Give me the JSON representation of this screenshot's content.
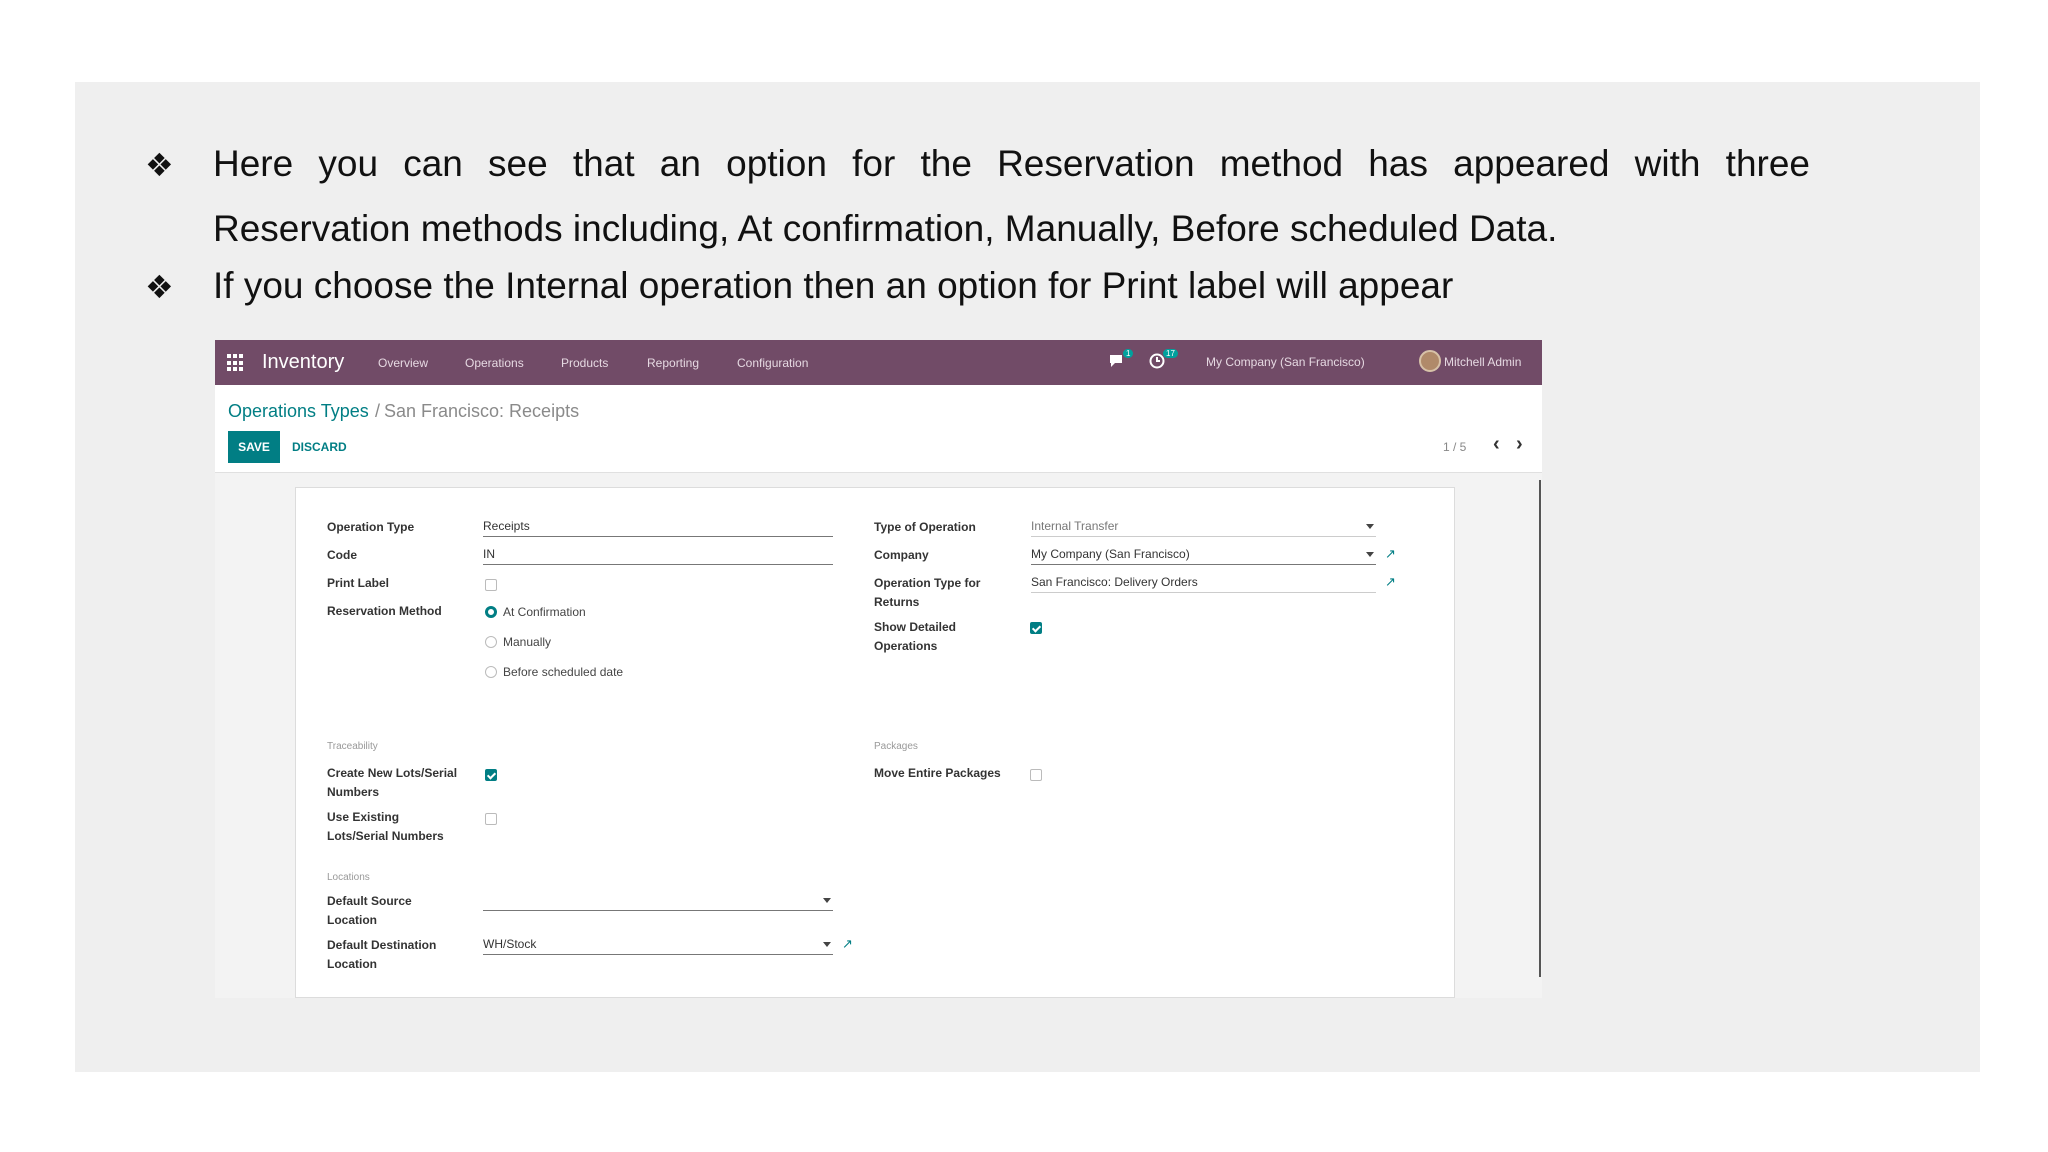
{
  "slide": {
    "bullets": [
      {
        "lines": [
          "Here you can see that an option for the Reservation method has appeared with three",
          "Reservation methods including, At confirmation, Manually, Before scheduled Data."
        ]
      },
      {
        "lines": [
          "If you choose the Internal operation then an option for Print label will appear"
        ]
      }
    ],
    "bullet_glyph": "❖",
    "arrow_color": "#e8262b"
  },
  "app": {
    "name": "Inventory",
    "brand_color": "#714b67",
    "accent_color": "#017e84",
    "menu": [
      "Overview",
      "Operations",
      "Products",
      "Reporting",
      "Configuration"
    ],
    "messages_badge": "1",
    "activities_badge": "17",
    "company": "My Company (San Francisco)",
    "user": "Mitchell Admin",
    "icons": [
      "apps-grid-icon",
      "chat-icon",
      "clock-icon",
      "external-link-icon",
      "chevron-left-icon",
      "chevron-right-icon"
    ]
  },
  "breadcrumb": {
    "parent": "Operations Types",
    "separator": "/",
    "current": "San Francisco: Receipts"
  },
  "actions": {
    "save": "SAVE",
    "discard": "DISCARD"
  },
  "pager": {
    "value": "1 / 5",
    "prev": "‹",
    "next": "›"
  },
  "form": {
    "left": {
      "operation_type_label": "Operation Type",
      "operation_type_value": "Receipts",
      "code_label": "Code",
      "code_value": "IN",
      "print_label_label": "Print Label",
      "print_label_checked": false,
      "reservation_label": "Reservation Method",
      "reservation_options": [
        "At Confirmation",
        "Manually",
        "Before scheduled date"
      ],
      "reservation_selected": "At Confirmation"
    },
    "right": {
      "type_of_operation_label": "Type of Operation",
      "type_of_operation_value": "Internal Transfer",
      "company_label": "Company",
      "company_value": "My Company (San Francisco)",
      "return_type_label_1": "Operation Type for",
      "return_type_label_2": "Returns",
      "return_type_value": "San Francisco: Delivery Orders",
      "show_detailed_label_1": "Show Detailed",
      "show_detailed_label_2": "Operations",
      "show_detailed_checked": true
    },
    "traceability": {
      "section": "Traceability",
      "create_lots_label_1": "Create New Lots/Serial",
      "create_lots_label_2": "Numbers",
      "create_lots_checked": true,
      "use_existing_label_1": "Use Existing",
      "use_existing_label_2": "Lots/Serial Numbers",
      "use_existing_checked": false
    },
    "packages": {
      "section": "Packages",
      "move_entire_label": "Move Entire Packages",
      "move_entire_checked": false
    },
    "locations": {
      "section": "Locations",
      "default_source_label_1": "Default Source",
      "default_source_label_2": "Location",
      "default_source_value": "",
      "default_dest_label_1": "Default Destination",
      "default_dest_label_2": "Location",
      "default_dest_value": "WH/Stock"
    }
  }
}
